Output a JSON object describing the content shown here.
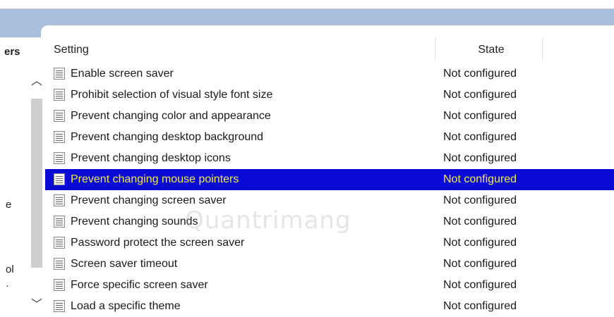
{
  "left_pane": {
    "header_fragment": "ers",
    "fragment_e": "e",
    "fragment_ol": "ol",
    "fragment_dot": "·"
  },
  "columns": {
    "setting": "Setting",
    "state": "State"
  },
  "rows": [
    {
      "label": "Enable screen saver",
      "state": "Not configured",
      "selected": false
    },
    {
      "label": "Prohibit selection of visual style font size",
      "state": "Not configured",
      "selected": false
    },
    {
      "label": "Prevent changing color and appearance",
      "state": "Not configured",
      "selected": false
    },
    {
      "label": "Prevent changing desktop background",
      "state": "Not configured",
      "selected": false
    },
    {
      "label": "Prevent changing desktop icons",
      "state": "Not configured",
      "selected": false
    },
    {
      "label": "Prevent changing mouse pointers",
      "state": "Not configured",
      "selected": true
    },
    {
      "label": "Prevent changing screen saver",
      "state": "Not configured",
      "selected": false
    },
    {
      "label": "Prevent changing sounds",
      "state": "Not configured",
      "selected": false
    },
    {
      "label": "Password protect the screen saver",
      "state": "Not configured",
      "selected": false
    },
    {
      "label": "Screen saver timeout",
      "state": "Not configured",
      "selected": false
    },
    {
      "label": "Force specific screen saver",
      "state": "Not configured",
      "selected": false
    },
    {
      "label": "Load a specific theme",
      "state": "Not configured",
      "selected": false
    }
  ],
  "icons": {
    "row_icon": "policy-setting-icon",
    "scroll_up": "chevron-up-icon",
    "scroll_down": "chevron-down-icon"
  },
  "watermark": "Quantrimang",
  "colors": {
    "selection_bg": "#0a0ad8",
    "selection_text": "#f3e84a",
    "band": "#a9bfdc"
  }
}
